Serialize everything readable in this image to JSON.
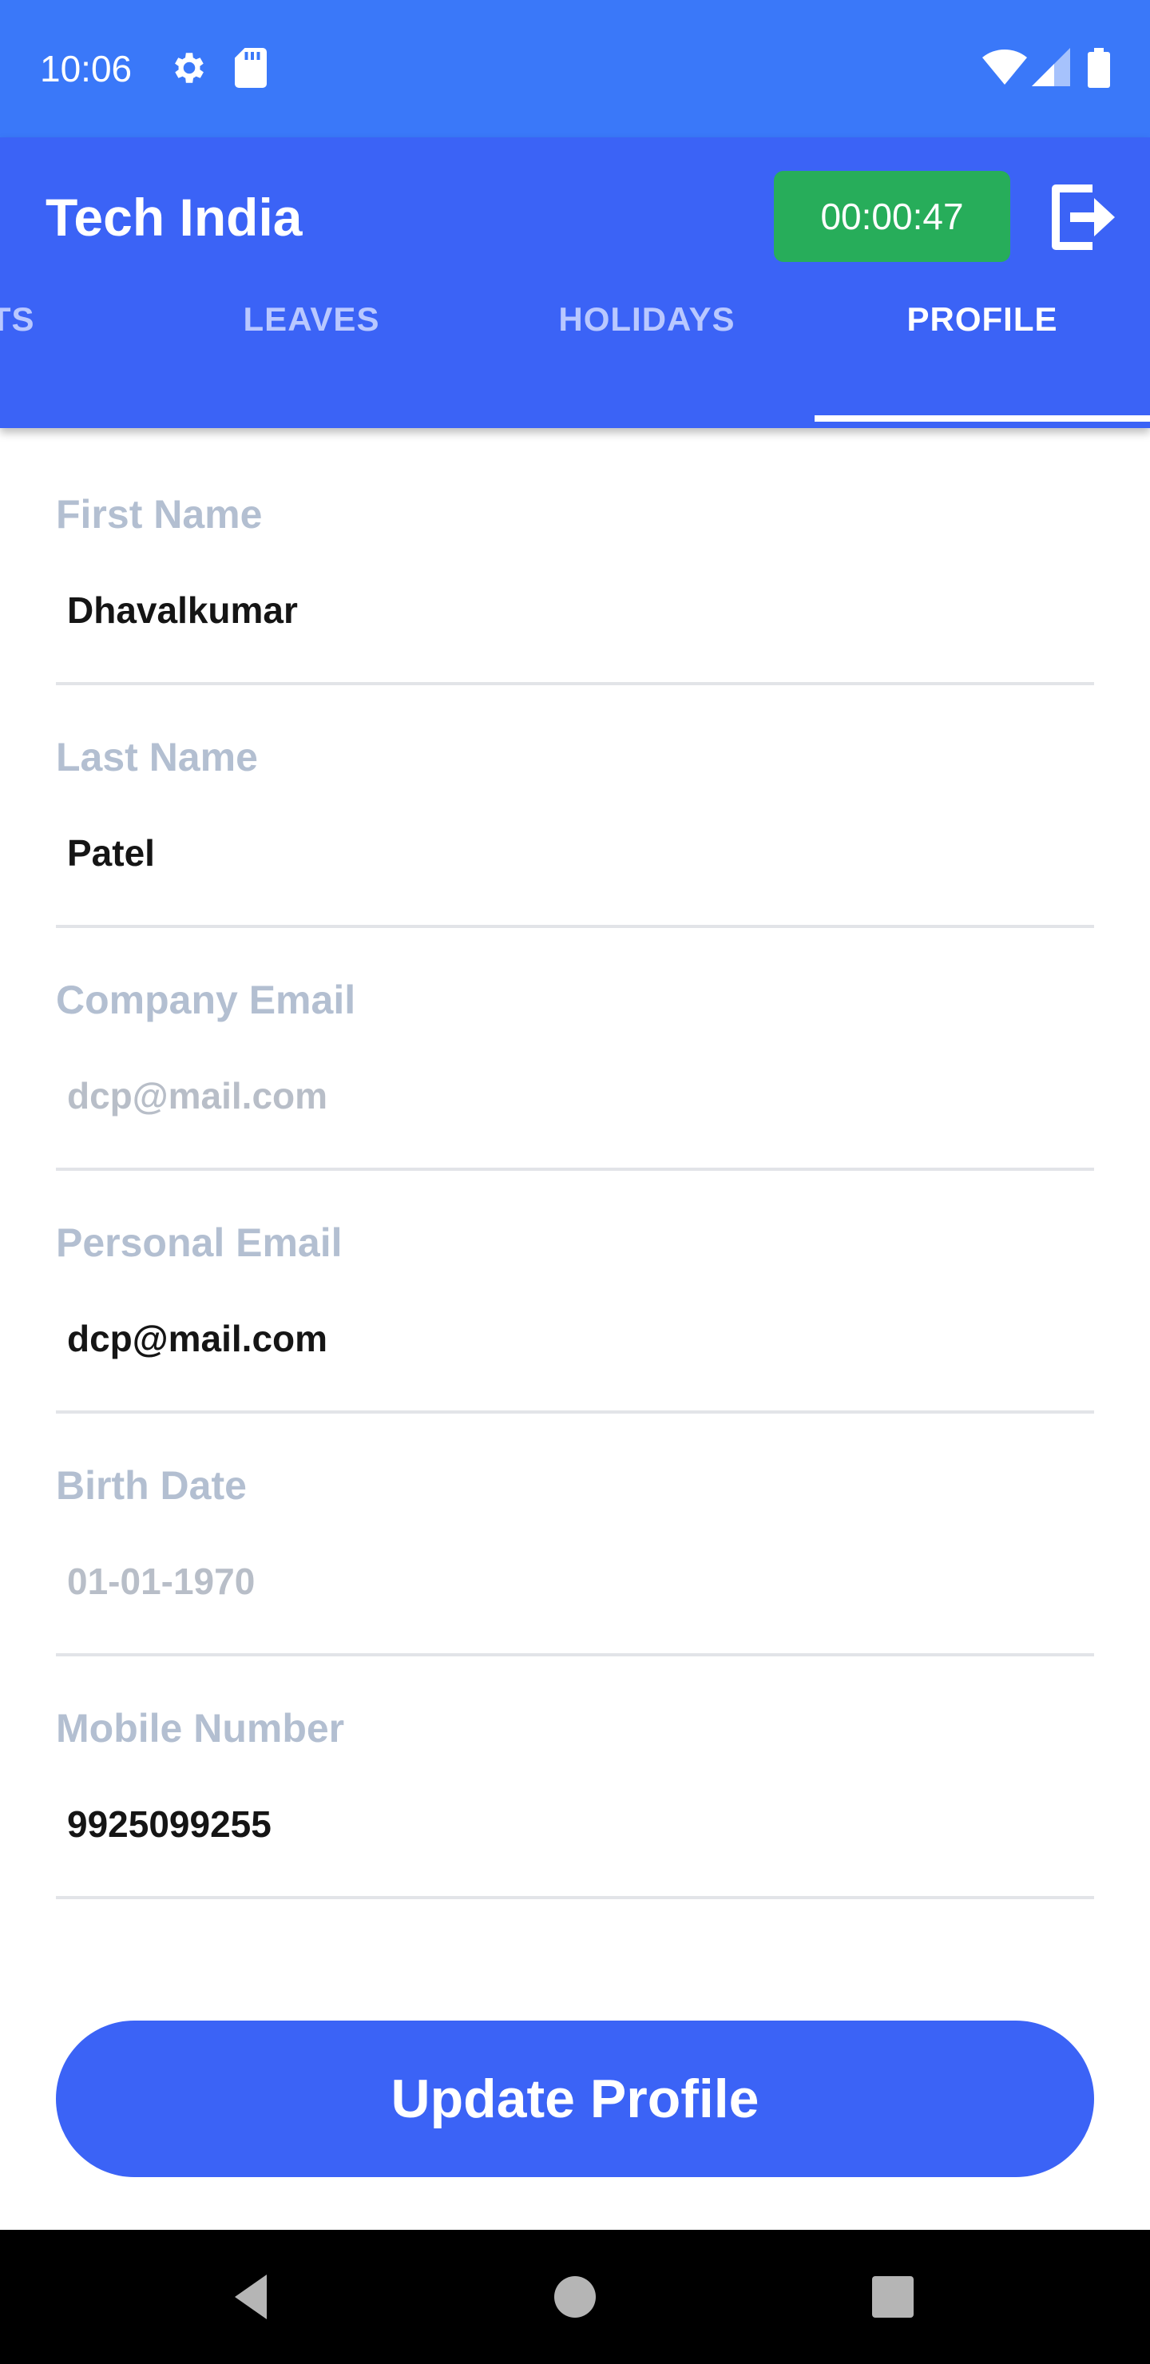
{
  "status_bar": {
    "time": "10:06",
    "icons": [
      "gear-icon",
      "sd-card-icon",
      "wifi-icon",
      "signal-icon",
      "battery-icon"
    ]
  },
  "app_bar": {
    "title": "Tech India",
    "timer": "00:00:47",
    "logout_icon": "logout-icon",
    "color": "#3b63f6",
    "timer_color": "#27ad5a"
  },
  "tabs": [
    {
      "label": "CTS",
      "active": false
    },
    {
      "label": "LEAVES",
      "active": false
    },
    {
      "label": "HOLIDAYS",
      "active": false
    },
    {
      "label": "PROFILE",
      "active": true
    }
  ],
  "form": {
    "fields": [
      {
        "label": "First Name",
        "value": "Dhavalkumar",
        "editable": true
      },
      {
        "label": "Last Name",
        "value": "Patel",
        "editable": true
      },
      {
        "label": "Company Email",
        "value": "dcp@mail.com",
        "editable": false
      },
      {
        "label": "Personal Email",
        "value": "dcp@mail.com",
        "editable": true
      },
      {
        "label": "Birth Date",
        "value": "01-01-1970",
        "editable": false
      },
      {
        "label": "Mobile Number",
        "value": "9925099255",
        "editable": true
      }
    ]
  },
  "update_button": {
    "label": "Update Profile"
  },
  "nav_bar": {
    "icons": [
      "back-icon",
      "home-icon",
      "recents-icon"
    ]
  }
}
